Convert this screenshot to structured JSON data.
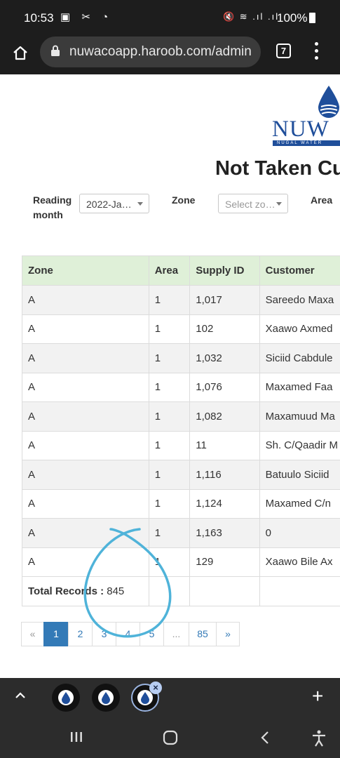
{
  "status_bar": {
    "time": "10:53",
    "left_icons": "▣ ✂ ◔",
    "right_icons": "🔇 ≋ .ıl .ıl",
    "battery": "100%"
  },
  "browser": {
    "url": "nuwacoapp.haroob.com/admin",
    "tab_count": "7"
  },
  "logo": {
    "brand": "NUW",
    "tagline": "NUGAL WATER"
  },
  "page": {
    "title": "Not Taken Cu",
    "filters": {
      "reading_month_label": "Reading month",
      "reading_month_value": "2022-Ja…",
      "zone_label": "Zone",
      "zone_placeholder": "Select zo…",
      "area_label": "Area"
    }
  },
  "table": {
    "headers": [
      "Zone",
      "Area",
      "Supply ID",
      "Customer"
    ],
    "rows": [
      [
        "A",
        "1",
        "1,017",
        "Sareedo Maxa"
      ],
      [
        "A",
        "1",
        "102",
        "Xaawo Axmed"
      ],
      [
        "A",
        "1",
        "1,032",
        "Siciid Cabdule"
      ],
      [
        "A",
        "1",
        "1,076",
        "Maxamed Faa"
      ],
      [
        "A",
        "1",
        "1,082",
        "Maxamuud Ma"
      ],
      [
        "A",
        "1",
        "11",
        "Sh. C/Qaadir M"
      ],
      [
        "A",
        "1",
        "1,116",
        "Batuulo Siciid"
      ],
      [
        "A",
        "1",
        "1,124",
        "Maxamed C/n"
      ],
      [
        "A",
        "1",
        "1,163",
        "0"
      ],
      [
        "A",
        "1",
        "129",
        "Xaawo Bile Ax"
      ]
    ],
    "total_label": "Total Records :",
    "total_value": "845"
  },
  "pagination": {
    "prev": "«",
    "pages": [
      "1",
      "2",
      "3",
      "4",
      "5"
    ],
    "ellipsis": "...",
    "last": "85",
    "next": "»",
    "active": "1"
  },
  "dock": {
    "plus": "+"
  },
  "colors": {
    "header_bg": "#dff0d8",
    "accent": "#337ab7",
    "brand": "#1f4e9a",
    "scribble": "#4fb3d9"
  }
}
